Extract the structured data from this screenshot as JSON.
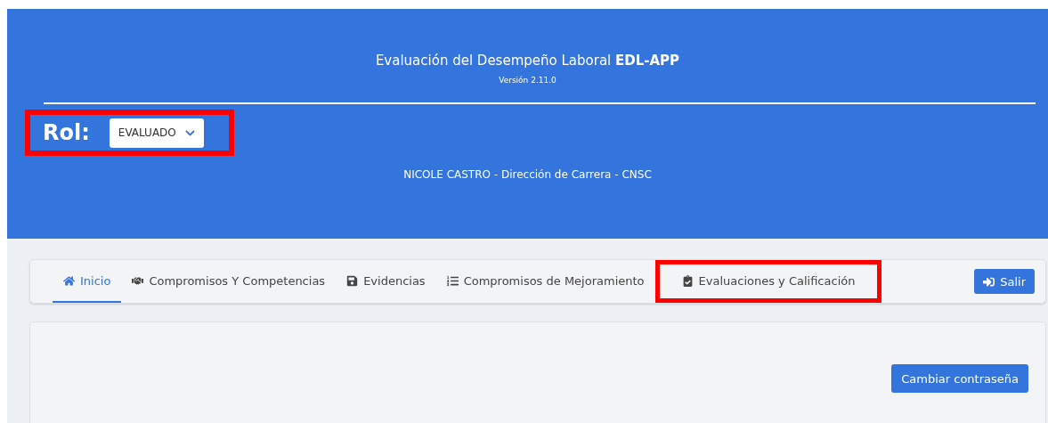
{
  "header": {
    "title": "Evaluación del Desempeño Laboral **EDL-APP**",
    "version": "Versión 2.11.0",
    "role_label": "Rol:",
    "role_select": {
      "value": "EVALUADO",
      "highlighted": true
    },
    "user_line": "NICOLE CASTRO - Dirección de Carrera - CNSC"
  },
  "nav": {
    "tabs": [
      {
        "label": "Inicio",
        "selected": true,
        "highlighted": false
      },
      {
        "label": "Compromisos Y Competencias",
        "selected": false,
        "highlighted": false
      },
      {
        "label": "Evidencias",
        "selected": false,
        "highlighted": false
      },
      {
        "label": "Compromisos de Mejoramiento",
        "selected": false,
        "highlighted": false
      },
      {
        "label": "Evaluaciones y Calificación",
        "selected": false,
        "highlighted": true
      }
    ],
    "logout_button": "Salir"
  },
  "content": {
    "change_password_button": "Cambiar contraseña"
  }
}
